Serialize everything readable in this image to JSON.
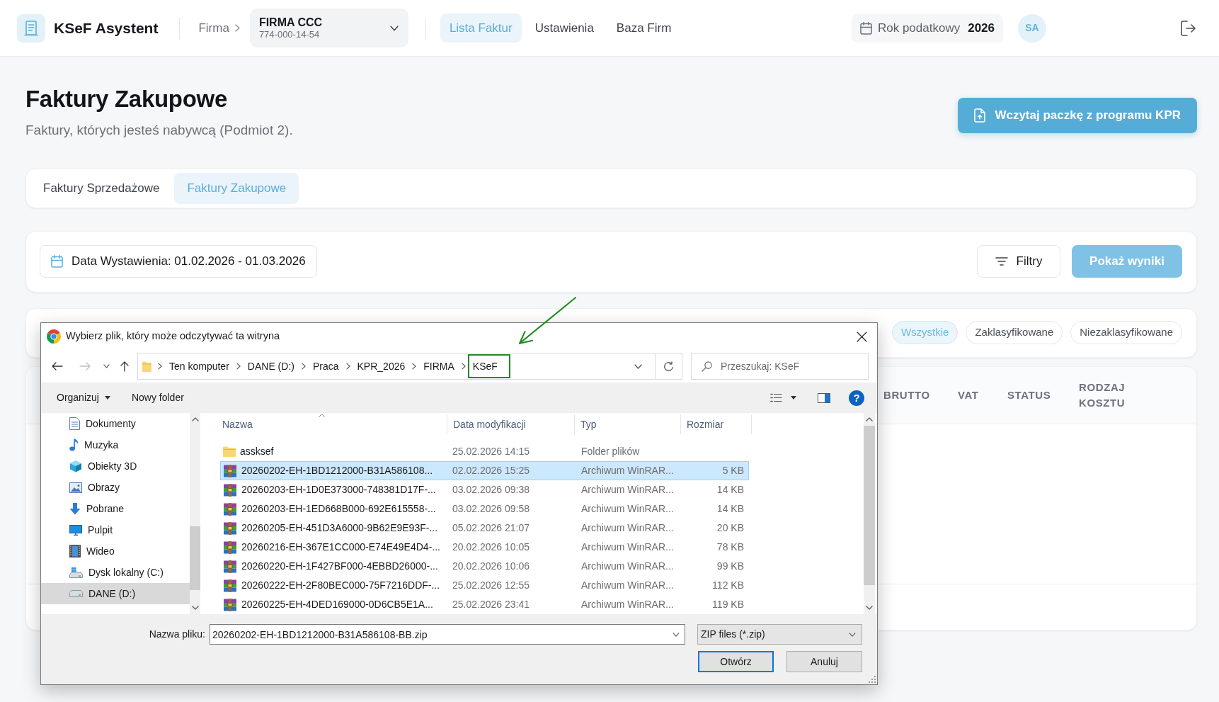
{
  "navbar": {
    "app_name": "KSeF Asystent",
    "company_label": "Firma",
    "company": {
      "name": "FIRMA CCC",
      "nip": "774-000-14-54"
    },
    "links": [
      {
        "label": "Lista Faktur",
        "selected": true
      },
      {
        "label": "Ustawienia",
        "selected": false
      },
      {
        "label": "Baza Firm",
        "selected": false
      }
    ],
    "tax_year": {
      "label": "Rok podatkowy",
      "value": "2026"
    },
    "avatar": "SA"
  },
  "page_header": {
    "title": "Faktury Zakupowe",
    "subtitle": "Faktury, których jesteś nabywcą (Podmiot 2).",
    "import_button": "Wczytaj paczkę z programu KPR"
  },
  "invoice_tabs": [
    {
      "label": "Faktury Sprzedażowe",
      "selected": false
    },
    {
      "label": "Faktury Zakupowe",
      "selected": true
    }
  ],
  "filters": {
    "date_range": "Data Wystawienia: 01.02.2026 - 01.03.2026",
    "filters_button": "Filtry",
    "search_button": "Pokaż wyniki"
  },
  "classification_chips": [
    {
      "label": "Wszystkie",
      "selected": true
    },
    {
      "label": "Zaklasyfikowane",
      "selected": false
    },
    {
      "label": "Niezaklasyfikowane",
      "selected": false
    }
  ],
  "table": {
    "columns": [
      "BRUTTO",
      "VAT",
      "STATUS",
      "RODZAJ KOSZTU"
    ]
  },
  "file_dialog": {
    "title": "Wybierz plik, który może odczytywać ta witryna",
    "forward_disabled": true,
    "breadcrumbs": [
      {
        "label": "Ten komputer",
        "highlighted": false
      },
      {
        "label": "DANE (D:)",
        "highlighted": false
      },
      {
        "label": "Praca",
        "highlighted": false
      },
      {
        "label": "KPR_2026",
        "highlighted": false
      },
      {
        "label": "FIRMA",
        "highlighted": false
      },
      {
        "label": "KSeF",
        "highlighted": true
      }
    ],
    "search_placeholder": "Przeszukaj: KSeF",
    "toolbar": {
      "organize": "Organizuj",
      "new_folder": "Nowy folder",
      "help_button": "?"
    },
    "nav_pane": [
      {
        "kind": "documents",
        "label": "Dokumenty",
        "selected": false
      },
      {
        "kind": "music",
        "label": "Muzyka",
        "selected": false
      },
      {
        "kind": "objects3d",
        "label": "Obiekty 3D",
        "selected": false
      },
      {
        "kind": "pictures",
        "label": "Obrazy",
        "selected": false
      },
      {
        "kind": "downloads",
        "label": "Pobrane",
        "selected": false
      },
      {
        "kind": "desktop",
        "label": "Pulpit",
        "selected": false
      },
      {
        "kind": "videos",
        "label": "Wideo",
        "selected": false
      },
      {
        "kind": "local-disk",
        "label": "Dysk lokalny (C:)",
        "selected": false
      },
      {
        "kind": "drive",
        "label": "DANE (D:)",
        "selected": true
      }
    ],
    "columns": [
      {
        "label": "Nazwa",
        "sorted": true
      },
      {
        "label": "Data modyfikacji",
        "sorted": false
      },
      {
        "label": "Typ",
        "sorted": false
      },
      {
        "label": "Rozmiar",
        "sorted": false
      }
    ],
    "files": [
      {
        "kind": "folder",
        "name": "assksef",
        "modified": "25.02.2026 14:15",
        "type": "Folder plików",
        "selected": false
      },
      {
        "kind": "archive",
        "name": "20260202-EH-1BD1212000-B31A586108...",
        "modified": "02.02.2026 15:25",
        "type": "Archiwum WinRAR...",
        "size": "5 KB",
        "selected": true
      },
      {
        "kind": "archive",
        "name": "20260203-EH-1D0E373000-748381D17F-...",
        "modified": "03.02.2026 09:38",
        "type": "Archiwum WinRAR...",
        "size": "14 KB",
        "selected": false
      },
      {
        "kind": "archive",
        "name": "20260203-EH-1ED668B000-692E615558-...",
        "modified": "03.02.2026 09:58",
        "type": "Archiwum WinRAR...",
        "size": "14 KB",
        "selected": false
      },
      {
        "kind": "archive",
        "name": "20260205-EH-451D3A6000-9B62E9E93F-...",
        "modified": "05.02.2026 21:07",
        "type": "Archiwum WinRAR...",
        "size": "20 KB",
        "selected": false
      },
      {
        "kind": "archive",
        "name": "20260216-EH-367E1CC000-E74E49E4D4-...",
        "modified": "20.02.2026 10:05",
        "type": "Archiwum WinRAR...",
        "size": "78 KB",
        "selected": false
      },
      {
        "kind": "archive",
        "name": "20260220-EH-1F427BF000-4EBBD26000-...",
        "modified": "20.02.2026 10:06",
        "type": "Archiwum WinRAR...",
        "size": "99 KB",
        "selected": false
      },
      {
        "kind": "archive",
        "name": "20260222-EH-2F80BEC000-75F7216DDF-...",
        "modified": "25.02.2026 12:55",
        "type": "Archiwum WinRAR...",
        "size": "112 KB",
        "selected": false
      },
      {
        "kind": "archive",
        "name": "20260225-EH-4DED169000-0D6CB5E1A...",
        "modified": "25.02.2026 23:41",
        "type": "Archiwum WinRAR...",
        "size": "119 KB",
        "selected": false
      }
    ],
    "file_name_label": "Nazwa pliku:",
    "file_name": "20260202-EH-1BD1212000-B31A586108-BB.zip",
    "file_type": "ZIP files (*.zip)",
    "open_button": "Otwórz",
    "cancel_button": "Anuluj"
  }
}
